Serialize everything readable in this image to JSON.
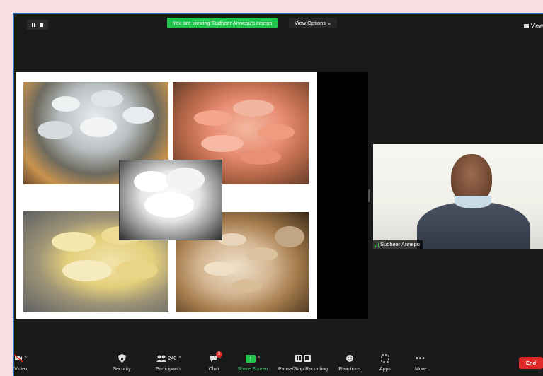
{
  "banner": {
    "text": "You are viewing Sudheer Annepu's screen"
  },
  "view_options": {
    "label": "View Options",
    "caret": "⌄"
  },
  "view_button": {
    "label": "View"
  },
  "speaker": {
    "name": "Sudheer Annepu"
  },
  "toolbar": {
    "video": {
      "label": "Video",
      "icon": "camera-off-icon"
    },
    "security": {
      "label": "Security",
      "icon": "shield-icon"
    },
    "participants": {
      "label": "Participants",
      "count": "240",
      "icon": "participants-icon"
    },
    "chat": {
      "label": "Chat",
      "badge": "3",
      "icon": "chat-icon"
    },
    "share_screen": {
      "label": "Share Screen",
      "icon": "share-screen-icon"
    },
    "recording": {
      "label": "Pause/Stop Recording",
      "icon": "pause-stop-icon"
    },
    "reactions": {
      "label": "Reactions",
      "icon": "reaction-icon"
    },
    "apps": {
      "label": "Apps",
      "icon": "apps-icon"
    },
    "more": {
      "label": "More",
      "icon": "more-icon"
    },
    "end": {
      "label": "End"
    }
  },
  "colors": {
    "banner_green": "#23c44c",
    "end_red": "#e02828",
    "window_bg": "#1a1a1a",
    "page_bg": "#f9dfe3"
  }
}
